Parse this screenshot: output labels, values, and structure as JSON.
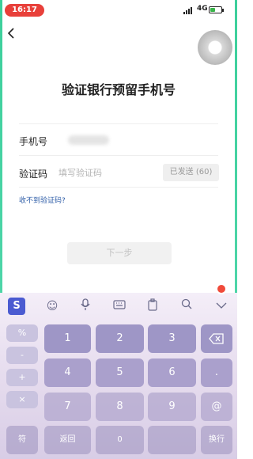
{
  "status_bar": {
    "time": "16:17",
    "network": "4G"
  },
  "header": {
    "title": "验证银行预留手机号"
  },
  "form": {
    "phone_label": "手机号",
    "code_label": "验证码",
    "code_placeholder": "填写验证码",
    "resend_label": "已发送 (60)",
    "help_link": "收不到验证码?"
  },
  "next_button": {
    "label": "下一步"
  },
  "keyboard": {
    "toolbar": [
      "sogou-logo",
      "emoji-icon",
      "microphone-icon",
      "keyboard-icon",
      "clipboard-icon",
      "search-icon",
      "collapse-icon"
    ],
    "side_keys": [
      "%",
      "-",
      "+",
      "×"
    ],
    "row1": [
      "1",
      "2",
      "3"
    ],
    "row2": [
      "4",
      "5",
      "6",
      "."
    ],
    "row3": [
      "7",
      "8",
      "9",
      "@"
    ],
    "bottom": [
      "符",
      "返回",
      "0",
      "",
      "换行"
    ]
  },
  "colors": {
    "accent_red": "#e8403a",
    "keyboard_key": "#9e96c6",
    "link_blue": "#2f5ea8"
  }
}
